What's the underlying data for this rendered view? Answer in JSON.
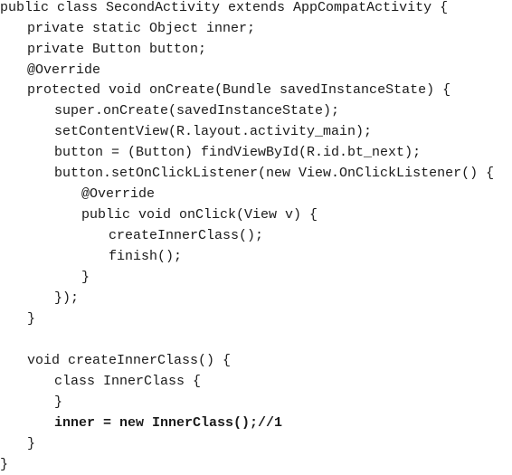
{
  "code": {
    "lines": [
      "public class SecondActivity extends AppCompatActivity {",
      "private static Object inner;",
      "private Button button;",
      "@Override",
      "protected void onCreate(Bundle savedInstanceState) {",
      "super.onCreate(savedInstanceState);",
      "setContentView(R.layout.activity_main);",
      "button = (Button) findViewById(R.id.bt_next);",
      "button.setOnClickListener(new View.OnClickListener() {",
      "@Override",
      "public void onClick(View v) {",
      "createInnerClass();",
      "finish();",
      "}",
      "});",
      "}",
      "",
      "void createInnerClass() {",
      "class InnerClass {",
      "}",
      "inner = new InnerClass();//1",
      "}",
      "}"
    ]
  }
}
